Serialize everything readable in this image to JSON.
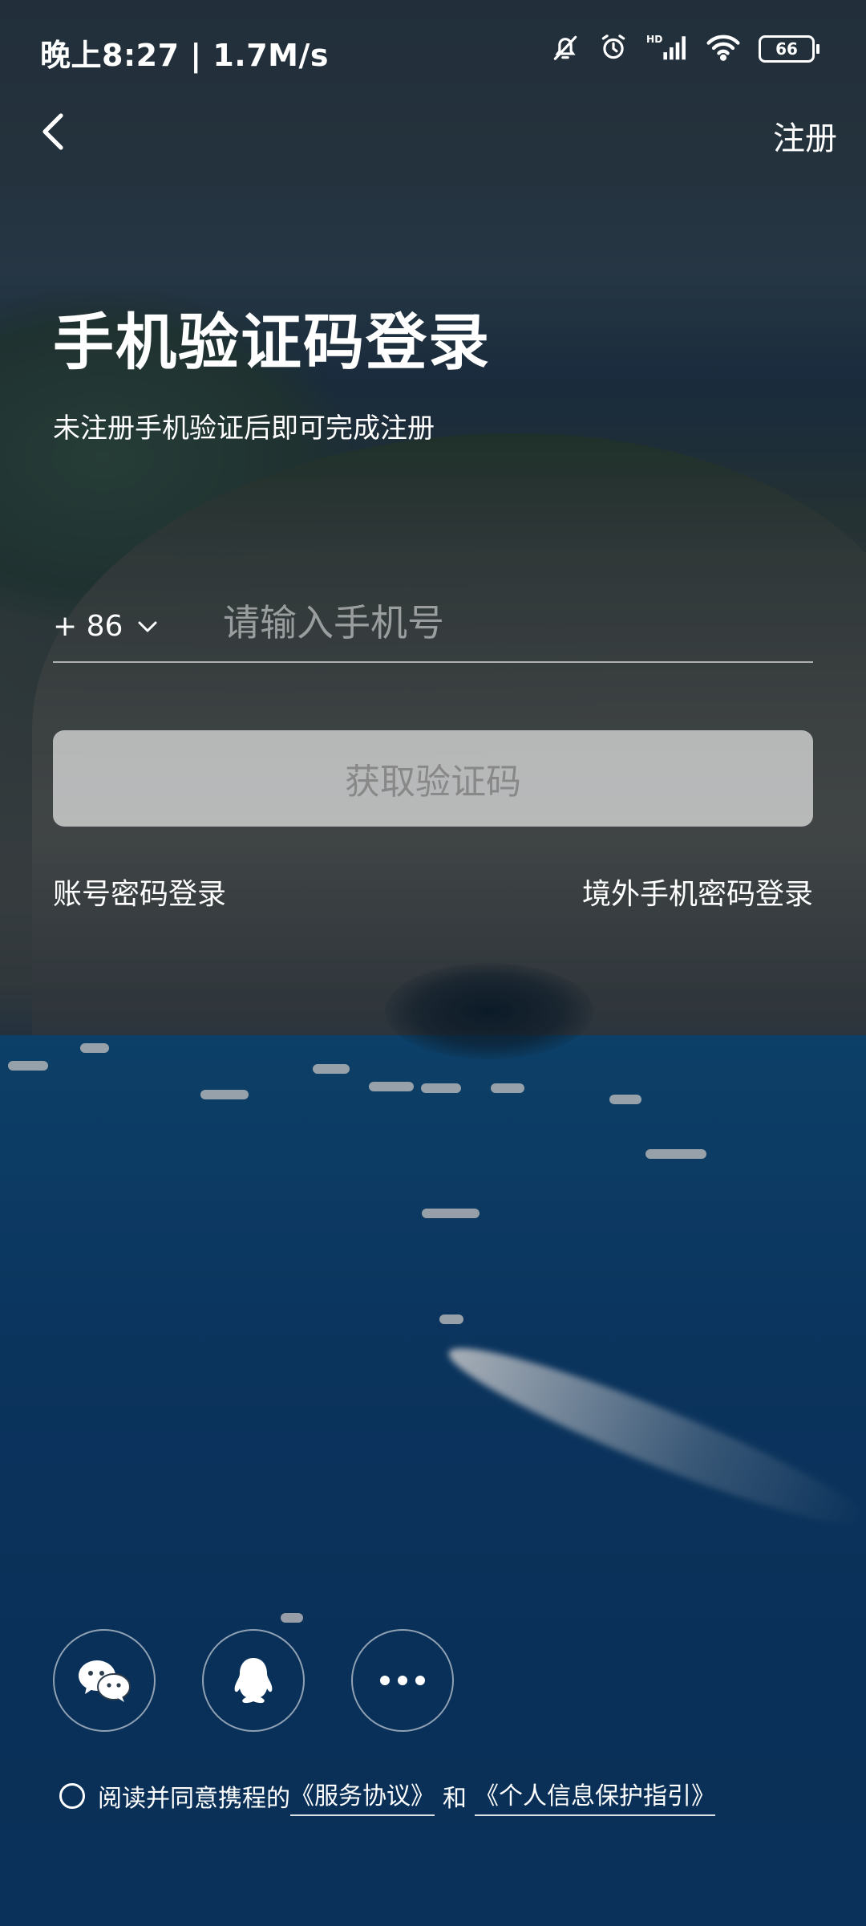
{
  "status_bar": {
    "time": "晚上8:27 | 1.7M/s",
    "battery": "66",
    "icons": [
      "mute-bell-icon",
      "alarm-icon",
      "hd-signal-icon",
      "wifi-icon",
      "battery-icon"
    ]
  },
  "nav": {
    "back_icon": "chevron-left-icon",
    "register_label": "注册"
  },
  "header": {
    "title": "手机验证码登录",
    "subtitle": "未注册手机验证后即可完成注册"
  },
  "form": {
    "country_code": "+ 86",
    "phone_placeholder": "请输入手机号",
    "phone_value": "",
    "get_code_label": "获取验证码"
  },
  "links": {
    "password_login": "账号密码登录",
    "overseas_login": "境外手机密码登录"
  },
  "social": {
    "items": [
      {
        "name": "wechat",
        "icon": "wechat-icon"
      },
      {
        "name": "qq",
        "icon": "qq-penguin-icon"
      },
      {
        "name": "more",
        "icon": "more-dots-icon"
      }
    ]
  },
  "agreement": {
    "checked": false,
    "prefix": "阅读并同意携程的",
    "service_terms": "《服务协议》",
    "conjunction": "和",
    "privacy_guide": "《个人信息保护指引》"
  }
}
